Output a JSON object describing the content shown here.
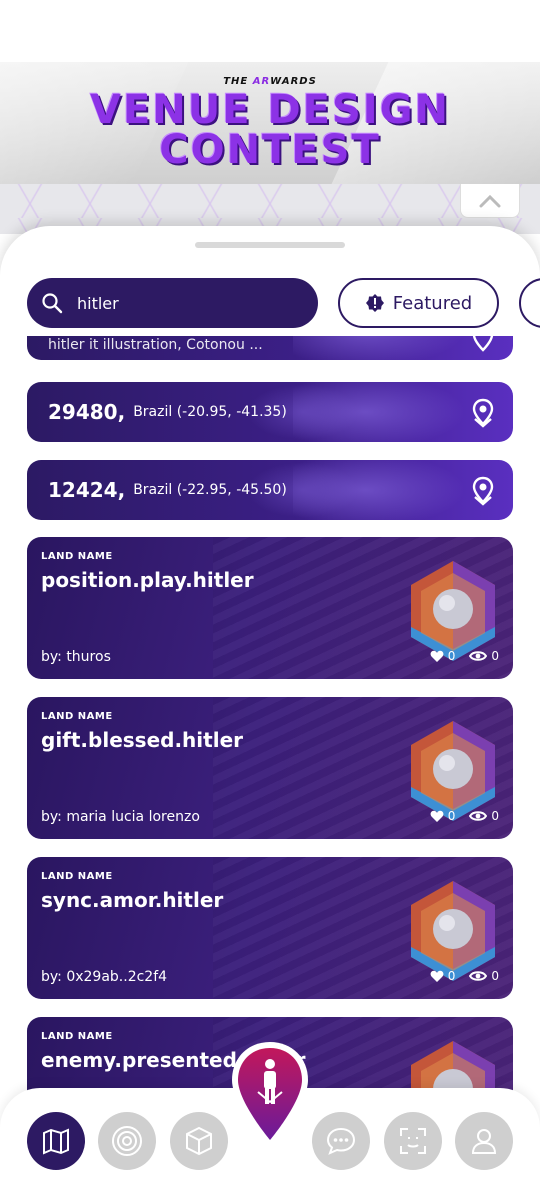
{
  "banner": {
    "kicker_prefix": "THE ",
    "kicker_accent": "AR",
    "kicker_suffix": "WARDS",
    "title_line1": "Venue Design",
    "title_line2": "Contest"
  },
  "search": {
    "value": "hitler"
  },
  "filter": {
    "featured_label": "Featured"
  },
  "partial_card": {
    "text": "hitler it illustration, Cotonou ..."
  },
  "coord_cards": [
    {
      "number": "29480,",
      "location": "Brazil (-20.95, -41.35)"
    },
    {
      "number": "12424,",
      "location": "Brazil (-22.95, -45.50)"
    }
  ],
  "land_cards": [
    {
      "label": "LAND NAME",
      "name": "position.play.hitler",
      "by": "by: thuros",
      "likes": "0",
      "views": "0"
    },
    {
      "label": "LAND NAME",
      "name": "gift.blessed.hitler",
      "by": "by: maria lucia lorenzo",
      "likes": "0",
      "views": "0"
    },
    {
      "label": "LAND NAME",
      "name": "sync.amor.hitler",
      "by": "by: 0x29ab..2c2f4",
      "likes": "0",
      "views": "0"
    },
    {
      "label": "LAND NAME",
      "name": "enemy.presented.hitler",
      "by": "",
      "likes": "",
      "views": ""
    }
  ],
  "nav": {
    "items": [
      "map-icon",
      "radar-icon",
      "cube-icon",
      "avatar-pin-icon",
      "chat-icon",
      "face-scan-icon",
      "profile-icon"
    ],
    "active": "map-icon"
  },
  "colors": {
    "primary": "#2d1a63",
    "accent_pink": "#c2185b",
    "purple_light": "#8c32e6"
  }
}
